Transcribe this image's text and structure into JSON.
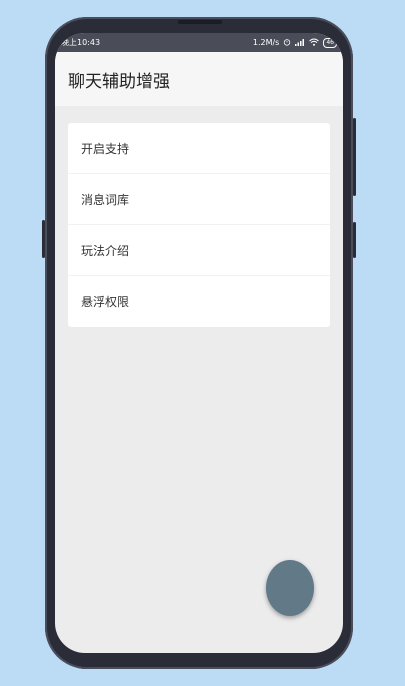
{
  "status_bar": {
    "time": "晚上10:43",
    "network_speed": "1.2M/s",
    "alarm_icon": "alarm-icon",
    "signal_icon": "signal-icon",
    "wifi_icon": "wifi-icon",
    "battery": "46"
  },
  "app_bar": {
    "title": "聊天辅助增强"
  },
  "menu": {
    "items": [
      {
        "label": "开启支持"
      },
      {
        "label": "消息词库"
      },
      {
        "label": "玩法介绍"
      },
      {
        "label": "悬浮权限"
      }
    ]
  },
  "fab": {
    "color": "#627987"
  }
}
